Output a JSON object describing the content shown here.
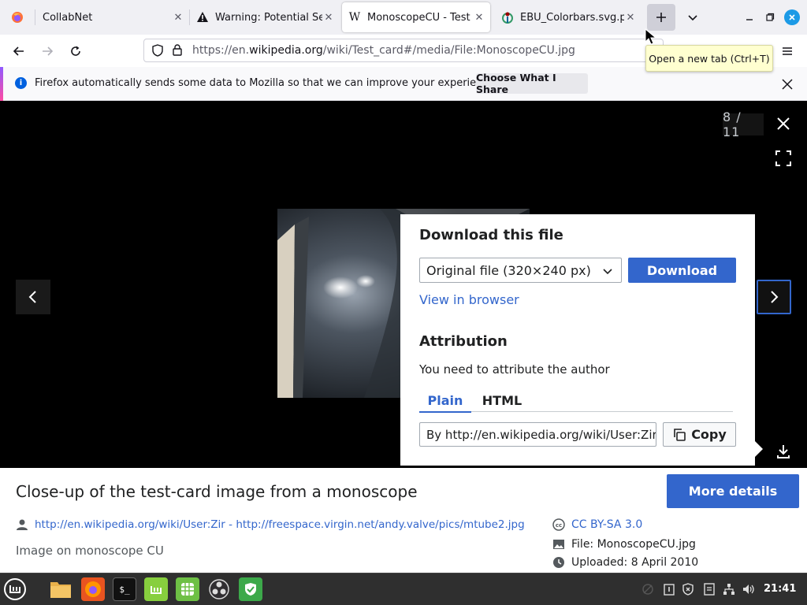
{
  "browser": {
    "tabs": [
      {
        "title": "CollabNet",
        "icon": "firefox-icon"
      },
      {
        "title": "Warning: Potential Sec",
        "icon": "warning-icon"
      },
      {
        "title": "MonoscopeCU - Test ca",
        "icon": "wikipedia-icon",
        "selected": true
      },
      {
        "title": "EBU_Colorbars.svg.png",
        "icon": "wikimedia-icon"
      }
    ],
    "url": {
      "prefix": "https://en.",
      "domain": "wikipedia.org",
      "path": "/wiki/Test_card#/media/File:MonoscopeCU.jpg"
    },
    "tooltip": "Open a new tab (Ctrl+T)"
  },
  "notification": {
    "text": "Firefox automatically sends some data to Mozilla so that we can improve your experience.",
    "button_label": "Choose What I Share"
  },
  "viewer": {
    "counter": "8 / 11",
    "download_dialog": {
      "heading": "Download this file",
      "selected_size": "Original file (320×240 px)",
      "download_label": "Download",
      "view_in_browser": "View in browser",
      "attribution_heading": "Attribution",
      "attribution_text": "You need to attribute the author",
      "tabs": [
        "Plain",
        "HTML"
      ],
      "attribution_value": "By http://en.wikipedia.org/wiki/User:Zir",
      "copy_label": "Copy"
    }
  },
  "info": {
    "caption": "Close-up of the test-card image from a monoscope",
    "more_details_label": "More details",
    "author": "http://en.wikipedia.org/wiki/User:Zir - http://freespace.virgin.net/andy.valve/pics/mtube2.jpg",
    "description": "Image on monoscope CU",
    "license": "CC BY-SA 3.0",
    "file": "File: MonoscopeCU.jpg",
    "uploaded": "Uploaded: 8 April 2010"
  },
  "taskbar": {
    "apps": [
      "linux-mint-menu-icon",
      "files-icon",
      "firefox-icon",
      "terminal-icon",
      "mintinstall-icon",
      "spreadsheet-icon",
      "obs-icon",
      "shield-icon"
    ],
    "clock": "21:41"
  },
  "colors": {
    "accent": "#3366cc",
    "tab_bar": "#f0f0f4",
    "taskbar": "#2f2f2f"
  }
}
